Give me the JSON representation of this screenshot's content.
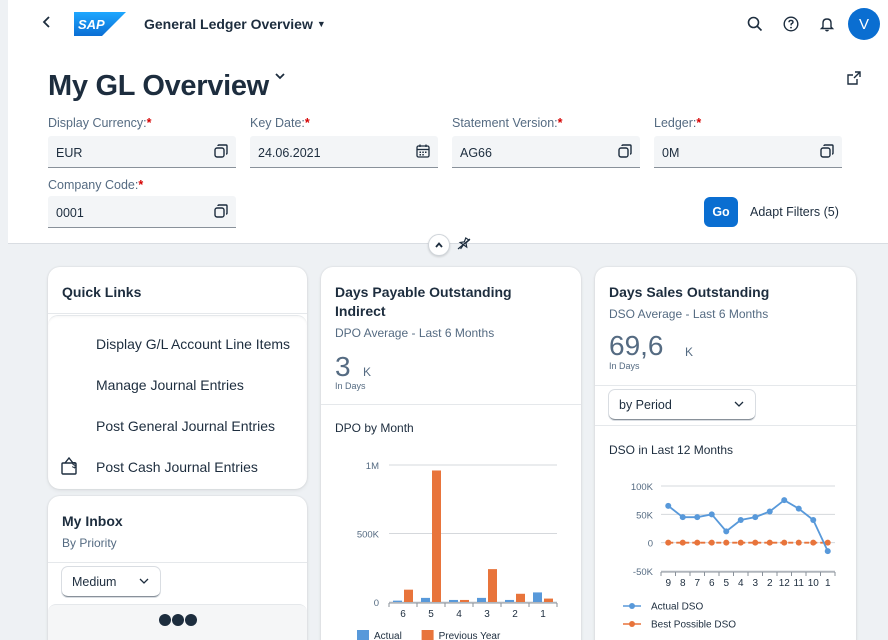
{
  "header": {
    "app_title": "General Ledger Overview",
    "page_title": "My GL Overview",
    "avatar_initial": "V",
    "logo_text": "SAP"
  },
  "filters": {
    "display_currency": {
      "label": "Display Currency:",
      "required": "*",
      "value": "EUR"
    },
    "key_date": {
      "label": "Key Date:",
      "required": "*",
      "value": "24.06.2021"
    },
    "statement_version": {
      "label": "Statement Version:",
      "required": "*",
      "value": "AG66"
    },
    "ledger": {
      "label": "Ledger:",
      "required": "*",
      "value": "0M"
    },
    "company_code": {
      "label": "Company Code:",
      "required": "*",
      "value": "0001"
    },
    "go_label": "Go",
    "adapt_label": "Adapt Filters (5)"
  },
  "quick_links": {
    "title": "Quick Links",
    "items": [
      {
        "label": "Display G/L Account Line Items"
      },
      {
        "label": "Manage Journal Entries"
      },
      {
        "label": "Post General Journal Entries"
      },
      {
        "label": "Post Cash Journal Entries"
      }
    ]
  },
  "inbox": {
    "title": "My Inbox",
    "subtitle": "By Priority",
    "priority": "Medium"
  },
  "dpo": {
    "title_line1": "Days Payable Outstanding",
    "title_line2": "Indirect",
    "subtitle": "DPO Average - Last 6 Months",
    "kpi_value": "3",
    "kpi_unit": "K",
    "kpi_note": "In Days",
    "chart_title": "DPO by Month"
  },
  "dso": {
    "title": "Days Sales Outstanding",
    "subtitle": "DSO Average - Last 6 Months",
    "kpi_value": "69,6",
    "kpi_unit": "K",
    "kpi_note": "In Days",
    "period_select": "by Period",
    "chart_title": "DSO in Last 12 Months"
  },
  "chart_data": [
    {
      "type": "bar",
      "categories": [
        "6",
        "5",
        "4",
        "3",
        "2",
        "1"
      ],
      "ytick_labels": [
        "1M",
        "500K",
        "0"
      ],
      "ylim": [
        0,
        1000000
      ],
      "series": [
        {
          "name": "Actual",
          "color": "#5899da",
          "values": [
            10000,
            30000,
            15000,
            30000,
            15000,
            70000
          ]
        },
        {
          "name": "Previous Year",
          "color": "#e8743b",
          "values": [
            90000,
            960000,
            15000,
            240000,
            60000,
            25000
          ]
        }
      ],
      "legend_position": "bottom"
    },
    {
      "type": "line",
      "categories": [
        "9",
        "8",
        "7",
        "6",
        "5",
        "4",
        "3",
        "2",
        "12",
        "11",
        "10",
        "1"
      ],
      "ytick_labels": [
        "100K",
        "50K",
        "0",
        "-50K"
      ],
      "ylim": [
        -50000,
        100000
      ],
      "series": [
        {
          "name": "Actual DSO",
          "color": "#5899da",
          "values": [
            65000,
            45000,
            45000,
            50000,
            20000,
            40000,
            45000,
            55000,
            75000,
            60000,
            40000,
            -15000
          ]
        },
        {
          "name": "Best Possible DSO",
          "color": "#e8743b",
          "values": [
            0,
            0,
            0,
            0,
            0,
            0,
            0,
            0,
            0,
            0,
            0,
            0
          ]
        }
      ],
      "legend_position": "bottom"
    }
  ]
}
